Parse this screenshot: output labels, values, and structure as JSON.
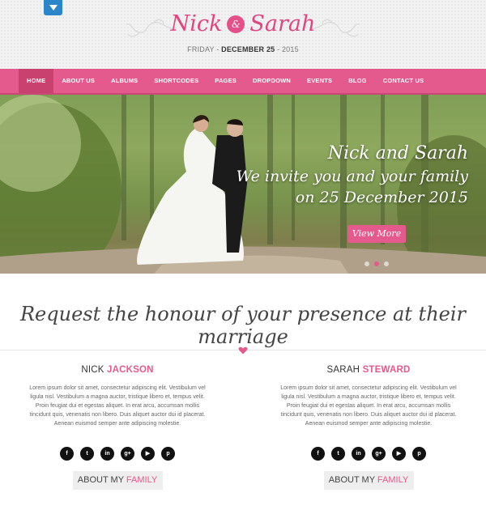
{
  "header": {
    "name_left": "Nick",
    "amp": "&",
    "name_right": "Sarah",
    "date_day": "FRIDAY -",
    "date_main": "DECEMBER 25",
    "date_year": "- 2015"
  },
  "nav": {
    "items": [
      {
        "label": "HOME"
      },
      {
        "label": "ABOUT US"
      },
      {
        "label": "ALBUMS"
      },
      {
        "label": "SHORTCODES"
      },
      {
        "label": "PAGES"
      },
      {
        "label": "DROPDOWN"
      },
      {
        "label": "EVENTS"
      },
      {
        "label": "BLOG"
      },
      {
        "label": "CONTACT US"
      }
    ]
  },
  "hero": {
    "line1": "Nick and Sarah",
    "line2": "We invite you and your family",
    "line3": "on 25 December 2015",
    "button": "View More"
  },
  "main": {
    "tagline": "Request the honour of your presence at their marriage"
  },
  "people": [
    {
      "first": "NICK",
      "last": "JACKSON",
      "bio": "Lorem ipsum dolor sit amet, consectetur adipiscing elit. Vestibulum vel ligula nisl. Vestibulum a magna auctor, tristique libero et, tempus velit. Proin feugiat dui et egestas aliquet. In erat arcu, accumsan mollis tincidunt quis, venenatis non libero. Duis aliquet auctor dui id placerat. Aenean euismod semper ante adipiscing molestie.",
      "btn_a": "ABOUT MY",
      "btn_b": "FAMILY"
    },
    {
      "first": "SARAH",
      "last": "STEWARD",
      "bio": "Lorem ipsum dolor sit amet, consectetur adipiscing elit. Vestibulum vel ligula nisl. Vestibulum a magna auctor, tristique libero et, tempus velit. Proin feugiat dui et egestas aliquet. In erat arcu, accumsan mollis tincidunt quis, venenatis non libero. Duis aliquet auctor dui id placerat. Aenean euismod semper ante adipiscing molestie.",
      "btn_a": "ABOUT MY",
      "btn_b": "FAMILY"
    }
  ],
  "social_icons": [
    "facebook-icon",
    "twitter-icon",
    "linkedin-icon",
    "google-plus-icon",
    "youtube-icon",
    "pinterest-icon"
  ],
  "social_glyphs": [
    "f",
    "t",
    "in",
    "g+",
    "▶",
    "p"
  ],
  "colors": {
    "accent": "#e55a8c",
    "nav_active": "#c8416f",
    "dropdown": "#2a86c8"
  }
}
